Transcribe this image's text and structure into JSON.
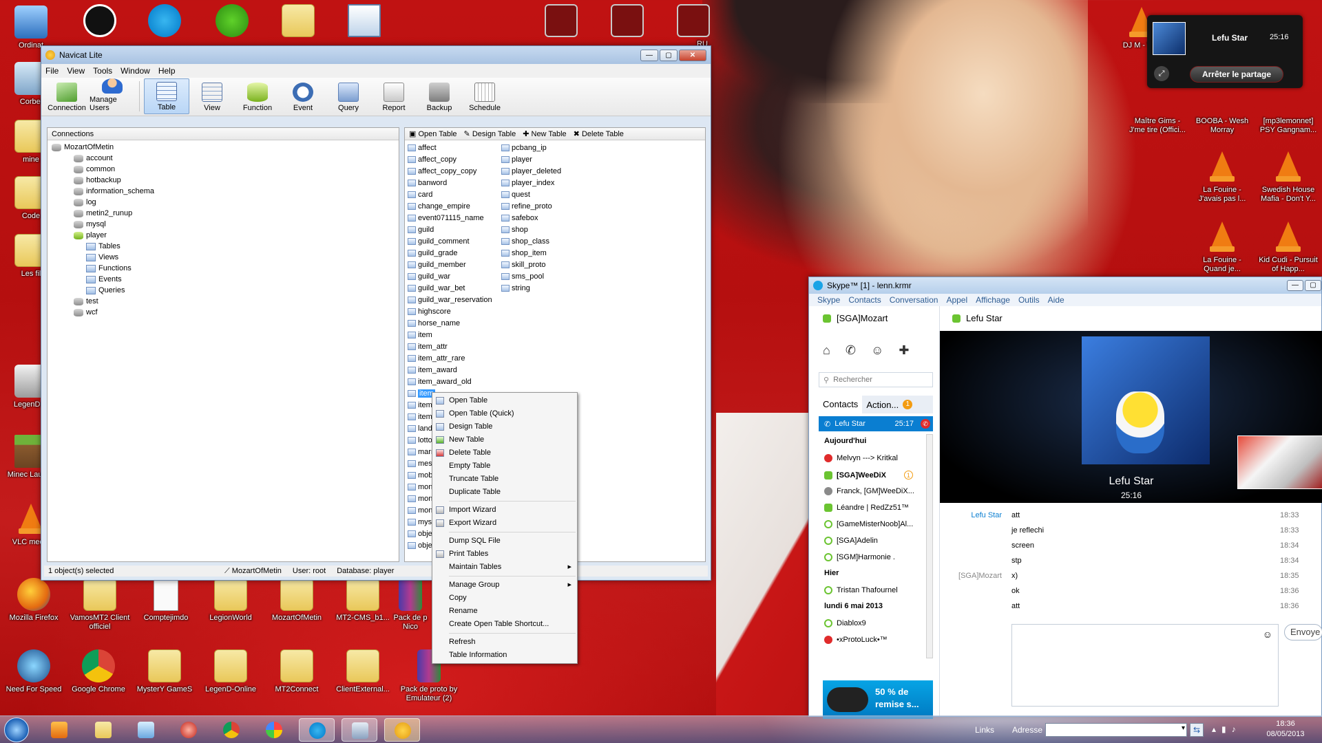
{
  "desktop": {
    "icons_left": [
      {
        "label": "Ordinat"
      },
      {
        "label": "Corbei"
      },
      {
        "label": "mine"
      },
      {
        "label": "Code"
      },
      {
        "label": "Les fil"
      },
      {
        "label": "LegenD-C"
      },
      {
        "label": "Minec Launch"
      },
      {
        "label": "VLC media"
      }
    ],
    "icons_bottom_row1": [
      {
        "label": "Mozilla Firefox"
      },
      {
        "label": "VamosMT2 Client officiel"
      },
      {
        "label": "Comptejimdo"
      },
      {
        "label": "LegionWorld"
      },
      {
        "label": "MozartOfMetin"
      },
      {
        "label": "MT2-CMS_b1..."
      },
      {
        "label": "Pack de p Nico"
      }
    ],
    "icons_bottom_row2": [
      {
        "label": "Need For Speed"
      },
      {
        "label": "Google Chrome"
      },
      {
        "label": "MysterY GameS"
      },
      {
        "label": "LegenD-Online"
      },
      {
        "label": "MT2Connect"
      },
      {
        "label": "ClientExternal..."
      },
      {
        "label": "Pack de proto by Emulateur (2)"
      }
    ],
    "icons_right": [
      {
        "label": "DJ M - Wat"
      },
      {
        "label": "Maître Gims - J'me tire (Offici..."
      },
      {
        "label": "BOOBA - Wesh Morray"
      },
      {
        "label": "[mp3lemonnet] PSY Gangnam..."
      },
      {
        "label": "La Fouine - J'avais pas l..."
      },
      {
        "label": "Swedish House Mafia - Don't Y..."
      },
      {
        "label": "La Fouine - Quand je..."
      },
      {
        "label": "Kid Cudi - Pursuit of Happ..."
      }
    ],
    "top_partial_label": "RU"
  },
  "navicat": {
    "title": "Navicat Lite",
    "menu": [
      "File",
      "View",
      "Tools",
      "Window",
      "Help"
    ],
    "toolbar": [
      {
        "label": "Connection",
        "icon": "connection-icon"
      },
      {
        "label": "Manage Users",
        "icon": "user-icon"
      },
      {
        "label": "Table",
        "icon": "table-icon",
        "active": true
      },
      {
        "label": "View",
        "icon": "view-icon"
      },
      {
        "label": "Function",
        "icon": "function-icon"
      },
      {
        "label": "Event",
        "icon": "event-icon"
      },
      {
        "label": "Query",
        "icon": "query-icon"
      },
      {
        "label": "Report",
        "icon": "report-icon"
      },
      {
        "label": "Backup",
        "icon": "backup-icon"
      },
      {
        "label": "Schedule",
        "icon": "schedule-icon"
      }
    ],
    "connections_header": "Connections",
    "tree": {
      "root": "MozartOfMetin",
      "databases": [
        "account",
        "common",
        "hotbackup",
        "information_schema",
        "log",
        "metin2_runup",
        "mysql"
      ],
      "open_db": "player",
      "open_children": [
        "Tables",
        "Views",
        "Functions",
        "Events",
        "Queries"
      ],
      "more_databases": [
        "test",
        "wcf"
      ]
    },
    "table_actions": [
      "Open Table",
      "Design Table",
      "New Table",
      "Delete Table"
    ],
    "tables_col1": [
      "affect",
      "affect_copy",
      "affect_copy_copy",
      "banword",
      "card",
      "change_empire",
      "event071115_name",
      "guild",
      "guild_comment",
      "guild_grade",
      "guild_member",
      "guild_war",
      "guild_war_bet",
      "guild_war_reservation",
      "highscore",
      "horse_name",
      "item",
      "item_attr",
      "item_attr_rare",
      "item_award",
      "item_award_old",
      "item",
      "item",
      "item",
      "land",
      "lotto",
      "marr",
      "mess",
      "mob_",
      "mon",
      "mon",
      "mon",
      "mys",
      "obje",
      "obje"
    ],
    "tables_col2": [
      "pcbang_ip",
      "player",
      "player_deleted",
      "player_index",
      "quest",
      "refine_proto",
      "safebox",
      "shop",
      "shop_class",
      "shop_item",
      "skill_proto",
      "sms_pool",
      "string"
    ],
    "selected_index": 21,
    "status": {
      "selected": "1 object(s) selected",
      "connection": "MozartOfMetin",
      "user": "User: root",
      "database": "Database: player"
    }
  },
  "context_menu": {
    "groups": [
      [
        {
          "label": "Open Table",
          "icon": "open-table-icon"
        },
        {
          "label": "Open Table (Quick)",
          "icon": "open-table-quick-icon"
        },
        {
          "label": "Design Table",
          "icon": "design-table-icon"
        },
        {
          "label": "New Table",
          "icon": "new-table-icon"
        },
        {
          "label": "Delete Table",
          "icon": "delete-table-icon"
        },
        {
          "label": "Empty Table"
        },
        {
          "label": "Truncate Table"
        },
        {
          "label": "Duplicate Table"
        }
      ],
      [
        {
          "label": "Import Wizard",
          "icon": "import-icon"
        },
        {
          "label": "Export Wizard",
          "icon": "export-icon"
        }
      ],
      [
        {
          "label": "Dump SQL File"
        },
        {
          "label": "Print Tables",
          "icon": "print-icon"
        },
        {
          "label": "Maintain Tables",
          "sub": true
        }
      ],
      [
        {
          "label": "Manage Group",
          "sub": true
        },
        {
          "label": "Copy"
        },
        {
          "label": "Rename"
        },
        {
          "label": "Create Open Table Shortcut..."
        }
      ],
      [
        {
          "label": "Refresh"
        },
        {
          "label": "Table Information"
        }
      ]
    ]
  },
  "share_popup": {
    "name": "Lefu Star",
    "time": "25:16",
    "button": "Arrêter le partage"
  },
  "skype": {
    "title": "Skype™ [1] - lenn.krmr",
    "menu": [
      "Skype",
      "Contacts",
      "Conversation",
      "Appel",
      "Affichage",
      "Outils",
      "Aide"
    ],
    "user": "[SGA]Mozart",
    "search_placeholder": "Rechercher",
    "tabs": {
      "contacts": "Contacts",
      "actions": "Action...",
      "badge": "1"
    },
    "active_call": {
      "name": "Lefu Star",
      "time": "25:17"
    },
    "sections": {
      "today": "Aujourd'hui",
      "yesterday": "Hier",
      "date": "lundi 6 mai 2013"
    },
    "contacts_today": [
      {
        "name": "Melvyn ---> Kritkal",
        "status": "busy"
      },
      {
        "name": "[SGA]WeeDiX",
        "status": "ok",
        "bold": true,
        "badge": "1"
      },
      {
        "name": "Franck, [GM]WeeDiX...",
        "status": "group"
      },
      {
        "name": "Léandre | RedZz51™",
        "status": "ok"
      },
      {
        "name": "[GameMisterNoob]Al...",
        "status": "away"
      },
      {
        "name": "[SGA]Adelin",
        "status": "away"
      },
      {
        "name": "[SGM]Harmonie .",
        "status": "away"
      }
    ],
    "contacts_yesterday": [
      {
        "name": "Tristan Thafournel",
        "status": "away"
      }
    ],
    "contacts_date": [
      {
        "name": "Diablox9",
        "status": "away"
      },
      {
        "name": "•xProtoLuck•™",
        "status": "busy"
      }
    ],
    "ad": "50 % de remise s...",
    "conversation": {
      "name": "Lefu Star",
      "video_name": "Lefu Star",
      "video_time": "25:16",
      "messages": [
        {
          "sender": "Lefu Star",
          "text": "att",
          "time": "18:33"
        },
        {
          "sender": "",
          "text": "je reflechi",
          "time": "18:33"
        },
        {
          "sender": "",
          "text": "screen",
          "time": "18:34"
        },
        {
          "sender": "",
          "text": "stp",
          "time": "18:34"
        },
        {
          "sender": "[SGA]Mozart",
          "text": "x)",
          "time": "18:35"
        },
        {
          "sender": "",
          "text": "ok",
          "time": "18:36"
        },
        {
          "sender": "",
          "text": "att",
          "time": "18:36"
        }
      ],
      "send_button": "Envoye"
    }
  },
  "taskbar": {
    "links": "Links",
    "address_label": "Adresse",
    "clock_time": "18:36",
    "clock_date": "08/05/2013"
  },
  "colors": {
    "selection": "#3399ff",
    "skype_blue": "#0a7ed1",
    "status_online": "#6bc431",
    "status_busy": "#e02b2b"
  }
}
